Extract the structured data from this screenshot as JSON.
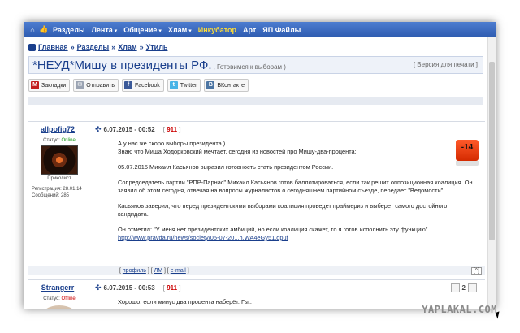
{
  "navbar": {
    "items": [
      "Разделы",
      "Лента",
      "Общение",
      "Хлам",
      "Инкубатор",
      "Арт",
      "ЯП Файлы"
    ]
  },
  "breadcrumb": {
    "items": [
      "Главная",
      "Разделы",
      "Хлам",
      "Утиль"
    ]
  },
  "topic": {
    "title": "*НЕУД*Мишу в президенты РФ.",
    "subtitle": ", Готовимся к выборам )",
    "print_link": "[ Версия для печати ]"
  },
  "share": {
    "buttons": [
      "Закладки",
      "Отправить",
      "Facebook",
      "Twitter",
      "ВКонтакте"
    ]
  },
  "posts": [
    {
      "author": "allpofig72",
      "status_label": "Статус:",
      "status": "Online",
      "rank": "Приколист",
      "reg_label": "Регистрация: 28.01.14",
      "msgs_label": "Сообщений: 285",
      "date": "6.07.2015 - 00:52",
      "post_id": "911",
      "rating": "-14",
      "body": [
        "А у нас же скоро выборы президента )",
        "Знаю что Миша Ходорковский мечтает, сегодня из новостей про Мишу-два-процента:",
        "05.07.2015 Михаил Касьянов выразил готовность стать президентом России.",
        "Сопредседатель партии \"РПР-Парнас\" Михаил Касьянов готов баллотироваться, если так решит оппозиционная коалиция. Он заявил об этом сегодня, отвечая на вопросы журналистов о сегодняшнем партийном съезде, передает \"Ведомости\".",
        "Касьянов заверил, что перед президентскими выборами коалиция проведет праймериз и выберет самого достойного кандидата.",
        "Он отметил: \"У меня нет президентских амбиций, но если коалиция скажет, то я готов исполнить эту функцию\"."
      ],
      "link": "http://www.pravda.ru/news/society/05-07-20...h.WA4eGy51.dpuf",
      "footer_links": [
        "профиль",
        "ЛМ",
        "e-mail"
      ],
      "up_button": "[^]"
    },
    {
      "author": "Strangerr",
      "status_label": "Статус:",
      "status": "Offline",
      "date": "6.07.2015 - 00:53",
      "post_id": "911",
      "rating": "2",
      "body": [
        "Хорошо, если минус два процента наберёт. Гы.."
      ]
    }
  ],
  "watermark": "YAPLAKAL.COM",
  "colors": {
    "nav_bg": "#2e5bb0",
    "link": "#1a3f8c",
    "highlight_nav": "#ffde36",
    "rating_bad": "#d42a00",
    "online": "#1a9a1a",
    "offline": "#cc0000"
  }
}
